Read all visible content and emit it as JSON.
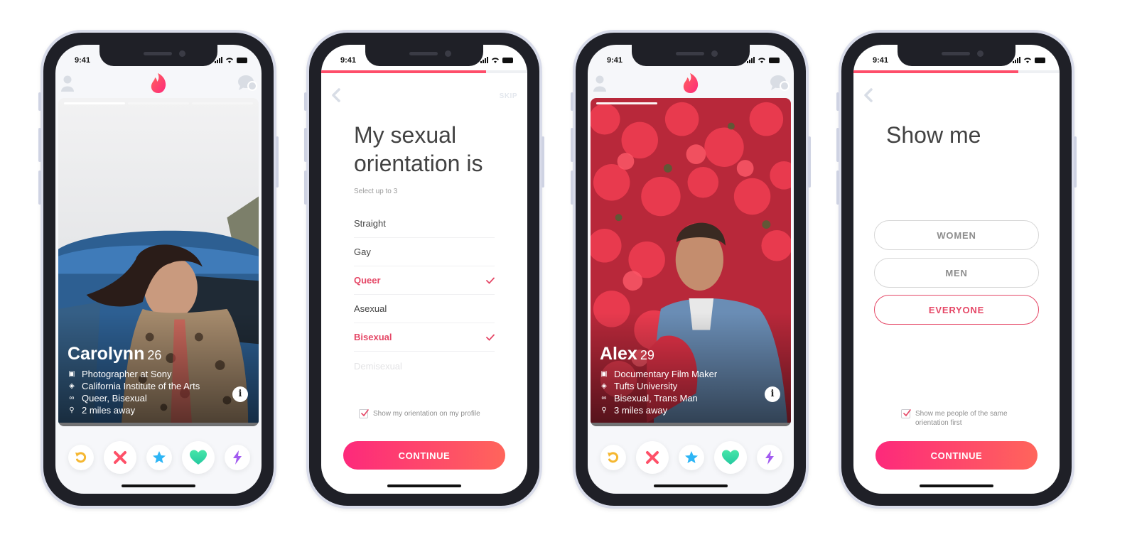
{
  "status_bar": {
    "time": "9:41"
  },
  "colors": {
    "brand": "#fe4e6a",
    "selected": "#e54766",
    "gradient_start": "#fd297b",
    "gradient_end": "#ff655b",
    "rewind": "#f5b731",
    "nope": "#fe5068",
    "superlike": "#2db5f5",
    "like": "#36d6a4",
    "boost": "#a25bf0"
  },
  "screens": [
    {
      "type": "profile-card",
      "nav": {
        "left_icon": "user-icon",
        "center_icon": "flame-logo",
        "right_icon": "chat-icon"
      },
      "photo_count": 3,
      "photo_index": 1,
      "profile": {
        "name": "Carolynn",
        "age": "26",
        "details": [
          {
            "icon": "briefcase-icon",
            "text": "Photographer at Sony"
          },
          {
            "icon": "graduation-cap-icon",
            "text": "California Institute of the Arts"
          },
          {
            "icon": "person-icon",
            "text": "Queer, Bisexual"
          },
          {
            "icon": "location-pin-icon",
            "text": "2 miles away"
          }
        ]
      },
      "actions": [
        "rewind",
        "nope",
        "super-like",
        "like",
        "boost"
      ]
    },
    {
      "type": "orientation",
      "progress": 0.8,
      "skip_label": "SKIP",
      "title_line1": "My sexual",
      "title_line2": "orientation is",
      "subtitle": "Select up to 3",
      "options": [
        {
          "label": "Straight",
          "selected": false
        },
        {
          "label": "Gay",
          "selected": false
        },
        {
          "label": "Queer",
          "selected": true
        },
        {
          "label": "Asexual",
          "selected": false
        },
        {
          "label": "Bisexual",
          "selected": true
        },
        {
          "label": "Demisexual",
          "selected": false
        }
      ],
      "checkbox_label": "Show my orientation on my profile",
      "checkbox_checked": true,
      "continue_label": "CONTINUE"
    },
    {
      "type": "profile-card",
      "nav": {
        "left_icon": "user-icon",
        "center_icon": "flame-logo",
        "right_icon": "chat-icon"
      },
      "photo_count": 3,
      "photo_index": 1,
      "profile": {
        "name": "Alex",
        "age": "29",
        "details": [
          {
            "icon": "briefcase-icon",
            "text": "Documentary Film Maker"
          },
          {
            "icon": "graduation-cap-icon",
            "text": "Tufts University"
          },
          {
            "icon": "person-icon",
            "text": "Bisexual, Trans Man"
          },
          {
            "icon": "location-pin-icon",
            "text": "3 miles away"
          }
        ]
      },
      "actions": [
        "rewind",
        "nope",
        "super-like",
        "like",
        "boost"
      ]
    },
    {
      "type": "show-me",
      "progress": 0.8,
      "title": "Show me",
      "choices": [
        {
          "label": "WOMEN",
          "selected": false
        },
        {
          "label": "MEN",
          "selected": false
        },
        {
          "label": "EVERYONE",
          "selected": true
        }
      ],
      "checkbox_label_line1": "Show me people of the same",
      "checkbox_label_line2": "orientation first",
      "checkbox_checked": true,
      "continue_label": "CONTINUE"
    }
  ]
}
